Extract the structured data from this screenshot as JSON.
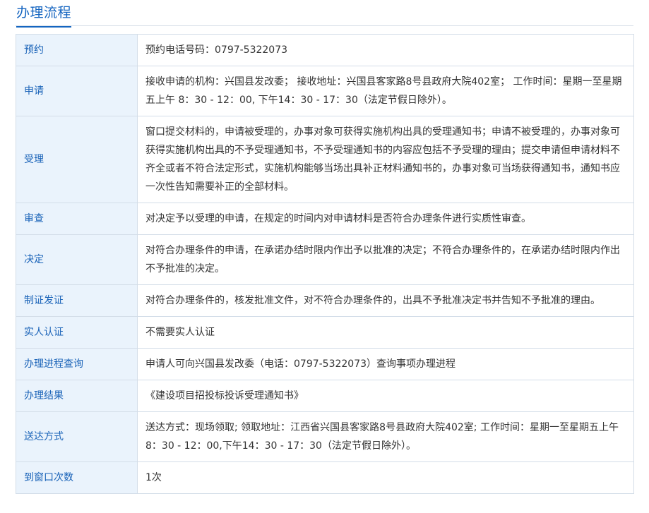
{
  "section_title": "办理流程",
  "colors": {
    "accent": "#1565c0",
    "label_bg": "#eaf3fc",
    "border": "#d3dde8"
  },
  "rows": [
    {
      "label": "预约",
      "value": "预约电话号码：0797-5322073"
    },
    {
      "label": "申请",
      "value": "接收申请的机构：兴国县发改委； 接收地址：兴国县客家路8号县政府大院402室； 工作时间：星期一至星期五上午 8：30 - 12：00, 下午14：30 - 17：30（法定节假日除外）。"
    },
    {
      "label": "受理",
      "value": "窗口提交材料的，申请被受理的，办事对象可获得实施机构出具的受理通知书；申请不被受理的，办事对象可获得实施机构出具的不予受理通知书，不予受理通知书的内容应包括不予受理的理由；提交申请但申请材料不齐全或者不符合法定形式，实施机构能够当场出具补正材料通知书的，办事对象可当场获得通知书，通知书应一次性告知需要补正的全部材料。"
    },
    {
      "label": "审查",
      "value": "对决定予以受理的申请，在规定的时间内对申请材料是否符合办理条件进行实质性审查。"
    },
    {
      "label": "决定",
      "value": "对符合办理条件的申请，在承诺办结时限内作出予以批准的决定；不符合办理条件的，在承诺办结时限内作出不予批准的决定。"
    },
    {
      "label": "制证发证",
      "value": "对符合办理条件的，核发批准文件，对不符合办理条件的，出具不予批准决定书并告知不予批准的理由。"
    },
    {
      "label": "实人认证",
      "value": "不需要实人认证"
    },
    {
      "label": "办理进程查询",
      "value": "申请人可向兴国县发改委（电话：0797-5322073）查询事项办理进程"
    },
    {
      "label": "办理结果",
      "value": "《建设项目招投标投诉受理通知书》"
    },
    {
      "label": "送达方式",
      "value": "送达方式：现场领取; 领取地址：江西省兴国县客家路8号县政府大院402室; 工作时间：星期一至星期五上午8：30 - 12：00,下午14：30 - 17：30（法定节假日除外）。"
    },
    {
      "label": "到窗口次数",
      "value": "1次"
    }
  ]
}
